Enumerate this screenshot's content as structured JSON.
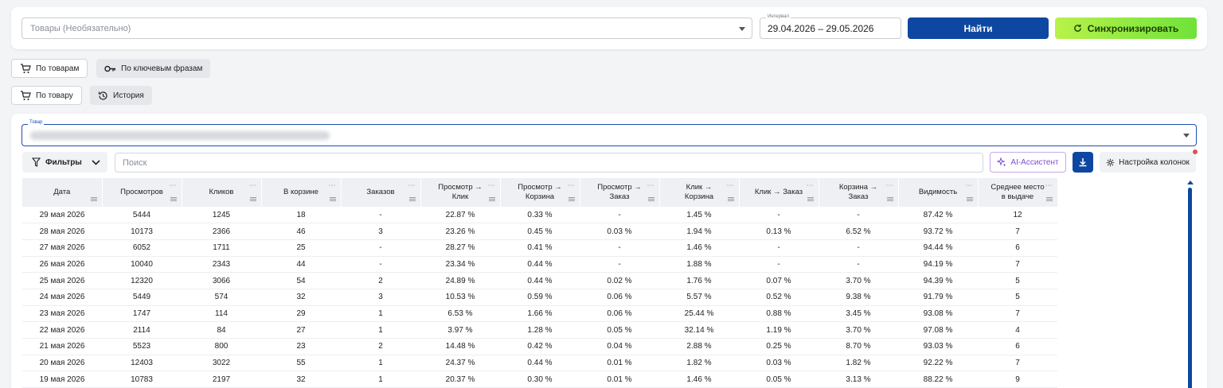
{
  "search_bar": {
    "products_placeholder": "Товары (Необязательно)",
    "interval_label": "Интервал",
    "interval_value": "29.04.2026 – 29.05.2026",
    "find_button": "Найти",
    "sync_button": "Синхронизировать"
  },
  "mode_tabs": [
    {
      "label": "По товарам",
      "icon": "cart-icon"
    },
    {
      "label": "По ключевым фразам",
      "icon": "key-icon"
    }
  ],
  "view_tabs": [
    {
      "label": "По товару",
      "icon": "cart-icon"
    },
    {
      "label": "История",
      "icon": "history-icon"
    }
  ],
  "product_select": {
    "label": "Товар"
  },
  "toolbar": {
    "filters_label": "Фильтры",
    "search_placeholder": "Поиск",
    "ai_label": "AI-Ассистент",
    "columns_label": "Настройка колонок"
  },
  "table": {
    "headers": [
      [
        "Дата"
      ],
      [
        "Просмотров"
      ],
      [
        "Кликов"
      ],
      [
        "В корзине"
      ],
      [
        "Заказов"
      ],
      [
        "Просмотр →",
        "Клик"
      ],
      [
        "Просмотр →",
        "Корзина"
      ],
      [
        "Просмотр →",
        "Заказ"
      ],
      [
        "Клик →",
        "Корзина"
      ],
      [
        "Клик → Заказ"
      ],
      [
        "Корзина →",
        "Заказ"
      ],
      [
        "Видимость"
      ],
      [
        "Среднее место",
        "в выдаче"
      ]
    ],
    "rows": [
      [
        "29 мая 2026",
        "5444",
        "1245",
        "18",
        "-",
        "22.87 %",
        "0.33 %",
        "-",
        "1.45 %",
        "-",
        "-",
        "87.42 %",
        "12"
      ],
      [
        "28 мая 2026",
        "10173",
        "2366",
        "46",
        "3",
        "23.26 %",
        "0.45 %",
        "0.03 %",
        "1.94 %",
        "0.13 %",
        "6.52 %",
        "93.72 %",
        "7"
      ],
      [
        "27 мая 2026",
        "6052",
        "1711",
        "25",
        "-",
        "28.27 %",
        "0.41 %",
        "-",
        "1.46 %",
        "-",
        "-",
        "94.44 %",
        "6"
      ],
      [
        "26 мая 2026",
        "10040",
        "2343",
        "44",
        "-",
        "23.34 %",
        "0.44 %",
        "-",
        "1.88 %",
        "-",
        "-",
        "94.19 %",
        "7"
      ],
      [
        "25 мая 2026",
        "12320",
        "3066",
        "54",
        "2",
        "24.89 %",
        "0.44 %",
        "0.02 %",
        "1.76 %",
        "0.07 %",
        "3.70 %",
        "94.39 %",
        "5"
      ],
      [
        "24 мая 2026",
        "5449",
        "574",
        "32",
        "3",
        "10.53 %",
        "0.59 %",
        "0.06 %",
        "5.57 %",
        "0.52 %",
        "9.38 %",
        "91.79 %",
        "5"
      ],
      [
        "23 мая 2026",
        "1747",
        "114",
        "29",
        "1",
        "6.53 %",
        "1.66 %",
        "0.06 %",
        "25.44 %",
        "0.88 %",
        "3.45 %",
        "93.08 %",
        "7"
      ],
      [
        "22 мая 2026",
        "2114",
        "84",
        "27",
        "1",
        "3.97 %",
        "1.28 %",
        "0.05 %",
        "32.14 %",
        "1.19 %",
        "3.70 %",
        "97.08 %",
        "4"
      ],
      [
        "21 мая 2026",
        "5523",
        "800",
        "23",
        "2",
        "14.48 %",
        "0.42 %",
        "0.04 %",
        "2.88 %",
        "0.25 %",
        "8.70 %",
        "93.03 %",
        "6"
      ],
      [
        "20 мая 2026",
        "12403",
        "3022",
        "55",
        "1",
        "24.37 %",
        "0.44 %",
        "0.01 %",
        "1.82 %",
        "0.03 %",
        "1.82 %",
        "92.22 %",
        "7"
      ],
      [
        "19 мая 2026",
        "10783",
        "2197",
        "32",
        "1",
        "20.37 %",
        "0.30 %",
        "0.01 %",
        "1.46 %",
        "0.05 %",
        "3.13 %",
        "88.22 %",
        "9"
      ]
    ]
  },
  "colors": {
    "primary": "#0d47a1",
    "sync_green": "#7ee23d",
    "ai_purple": "#7c4dcc"
  }
}
